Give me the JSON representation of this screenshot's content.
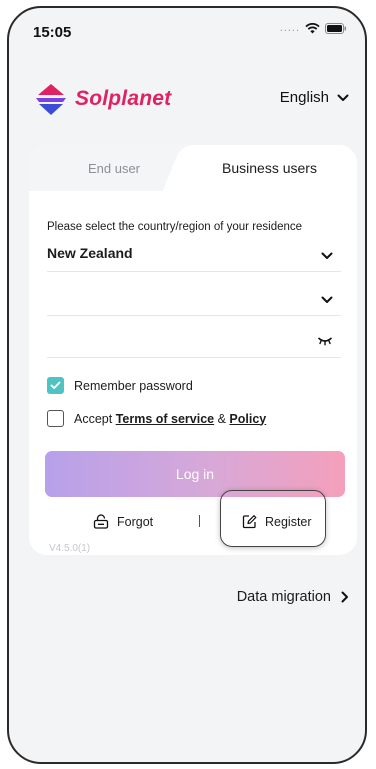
{
  "status_bar": {
    "time": "15:05",
    "signal": "....."
  },
  "header": {
    "brand_name": "Solplanet",
    "language": "English"
  },
  "tabs": [
    {
      "label": "End user",
      "active": false
    },
    {
      "label": "Business users",
      "active": true
    }
  ],
  "form": {
    "country_label": "Please select the country/region of your residence",
    "country_value": "New Zealand",
    "account_value": "",
    "password_value": "",
    "remember_label": "Remember password",
    "remember_checked": true,
    "accept_prefix": "Accept ",
    "terms_label": "Terms of service",
    "accept_and": " & ",
    "policy_label": "Policy",
    "accept_checked": false
  },
  "actions": {
    "login_label": "Log in",
    "forgot_label": "Forgot",
    "separator": "|",
    "register_label": "Register"
  },
  "version": "V4.5.0(1)",
  "footer": {
    "migration_label": "Data migration"
  },
  "colors": {
    "brand": "#e02260",
    "accent_check": "#4fc3c1",
    "login_gradient_start": "#b7a1ea",
    "login_gradient_end": "#f5a0bb"
  }
}
